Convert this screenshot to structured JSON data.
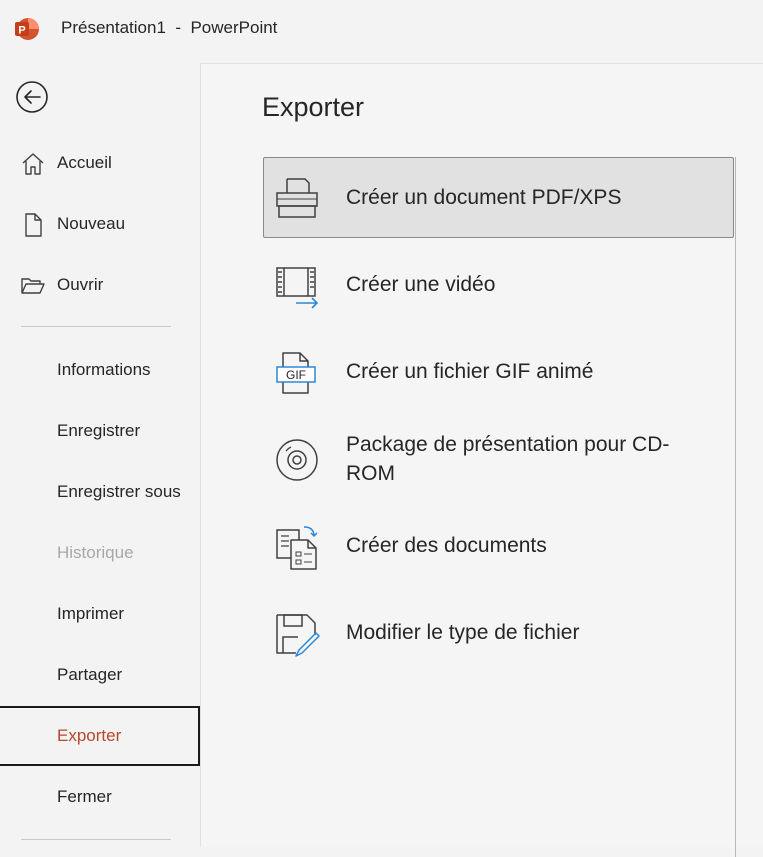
{
  "window": {
    "title": "Présentation1  -  PowerPoint",
    "logo_icon": "powerpoint-logo-icon",
    "accent_color": "#b7472a"
  },
  "sidebar": {
    "back_icon": "back-arrow-icon",
    "top_items": [
      {
        "label": "Accueil",
        "icon": "home-icon"
      },
      {
        "label": "Nouveau",
        "icon": "new-document-icon"
      },
      {
        "label": "Ouvrir",
        "icon": "open-folder-icon"
      }
    ],
    "items": [
      {
        "label": "Informations",
        "state": "normal"
      },
      {
        "label": "Enregistrer",
        "state": "normal"
      },
      {
        "label": "Enregistrer sous",
        "state": "normal"
      },
      {
        "label": "Historique",
        "state": "disabled"
      },
      {
        "label": "Imprimer",
        "state": "normal"
      },
      {
        "label": "Partager",
        "state": "normal"
      },
      {
        "label": "Exporter",
        "state": "selected"
      },
      {
        "label": "Fermer",
        "state": "normal"
      }
    ]
  },
  "main": {
    "title": "Exporter",
    "options": [
      {
        "label": "Créer un document PDF/XPS",
        "icon": "pdf-xps-document-icon",
        "selected": true
      },
      {
        "label": "Créer une vidéo",
        "icon": "video-export-icon",
        "selected": false
      },
      {
        "label": "Créer un fichier GIF animé",
        "icon": "gif-file-icon",
        "icon_text": "GIF",
        "selected": false
      },
      {
        "label": "Package de présentation pour CD-ROM",
        "icon": "cd-rom-icon",
        "selected": false
      },
      {
        "label": "Créer des documents",
        "icon": "handouts-document-icon",
        "selected": false
      },
      {
        "label": "Modifier le type de fichier",
        "icon": "change-file-type-icon",
        "selected": false
      }
    ]
  }
}
